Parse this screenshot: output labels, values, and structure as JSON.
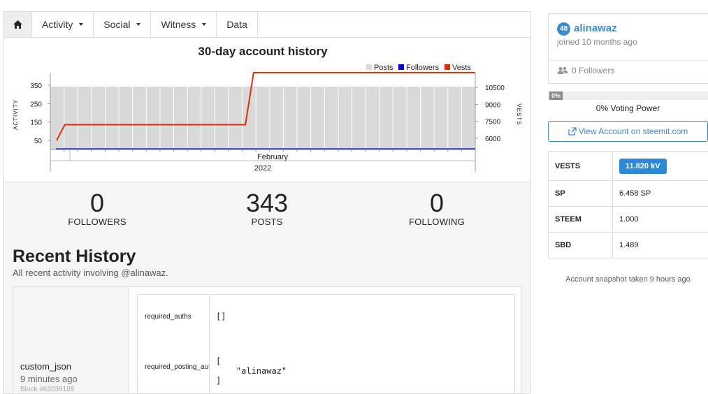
{
  "nav": {
    "home_icon": "home-icon",
    "items": [
      {
        "label": "Activity",
        "dropdown": true
      },
      {
        "label": "Social",
        "dropdown": true
      },
      {
        "label": "Witness",
        "dropdown": true
      },
      {
        "label": "Data",
        "dropdown": false
      }
    ]
  },
  "chart_data": {
    "type": "bar+line",
    "title": "30-day account history",
    "legend": [
      "Posts",
      "Followers",
      "Vests"
    ],
    "legend_placement": "top-right",
    "colors": {
      "posts": "#d9d9d9",
      "followers": "#0000cc",
      "vests": "#d9300b"
    },
    "ylabel_left": "ACTIVITY",
    "ylabel_right": "VESTS",
    "x_month_label": "February",
    "x_year_label": "2022",
    "left_ticks": [
      50,
      150,
      250,
      350
    ],
    "right_ticks": [
      6000,
      7500,
      9000,
      10500
    ],
    "left_ylim": [
      0,
      400
    ],
    "right_ylim": [
      5000,
      11500
    ],
    "series": [
      {
        "name": "Posts",
        "type": "bar",
        "values": [
          343,
          343,
          343,
          343,
          343,
          343,
          343,
          343,
          343,
          343,
          343,
          343,
          343,
          343,
          343,
          343,
          343,
          343,
          343,
          343,
          343,
          343,
          343,
          343,
          343,
          343,
          343,
          343,
          343,
          343,
          343
        ]
      },
      {
        "name": "Followers",
        "type": "line",
        "values": [
          0,
          0,
          0,
          0,
          0,
          0,
          0,
          0,
          0,
          0,
          0,
          0,
          0,
          0,
          0,
          0,
          0,
          0,
          0,
          0,
          0,
          0,
          0,
          0,
          0,
          0,
          0,
          0,
          0,
          0,
          0
        ]
      },
      {
        "name": "Vests",
        "type": "line",
        "values": [
          5800,
          7200,
          7200,
          7200,
          7200,
          7200,
          7200,
          7200,
          7200,
          7200,
          7200,
          7200,
          7200,
          7200,
          7200,
          7200,
          7200,
          7200,
          7200,
          7200,
          7200,
          7200,
          7200,
          7200,
          11820,
          11820,
          11820,
          11820,
          11820,
          11820,
          11820,
          11820,
          11820,
          11820,
          11820,
          11820,
          11820,
          11820,
          11820,
          11820,
          11820,
          11820,
          11820,
          11820,
          11820,
          11820,
          11820,
          11820,
          11820,
          11820,
          11820,
          11820
        ]
      }
    ]
  },
  "stats": [
    {
      "value": "0",
      "label": "FOLLOWERS"
    },
    {
      "value": "343",
      "label": "POSTS"
    },
    {
      "value": "0",
      "label": "FOLLOWING"
    }
  ],
  "recent_history": {
    "title": "Recent History",
    "subtitle": "All recent activity involving @alinawaz.",
    "entry": {
      "op": "custom_json",
      "time": "9 minutes ago",
      "block": "Block #62039189",
      "fields": [
        {
          "key": "required_auths",
          "value": "[]"
        },
        {
          "key": "required_posting_auths",
          "value": "[\n    \"alinawaz\"\n]"
        }
      ]
    }
  },
  "profile": {
    "reputation": "48",
    "username": "alinawaz",
    "joined": "joined 10 months ago",
    "followers": "0 Followers",
    "followers_icon": "users-icon"
  },
  "voting_power": {
    "percent_label": "0%",
    "value": 0,
    "text": "0% Voting Power"
  },
  "view_account": {
    "label": "View Account on steemit.com",
    "icon": "external-link-icon"
  },
  "balances": [
    {
      "key": "VESTS",
      "value": "11.820 kV"
    },
    {
      "key": "SP",
      "value": "6.458 SP"
    },
    {
      "key": "STEEM",
      "value": "1.000"
    },
    {
      "key": "SBD",
      "value": "1.489"
    }
  ],
  "snapshot": "Account snapshot taken 9 hours ago",
  "colors": {
    "accent": "#428bca",
    "badge": "#2b8ad8"
  }
}
